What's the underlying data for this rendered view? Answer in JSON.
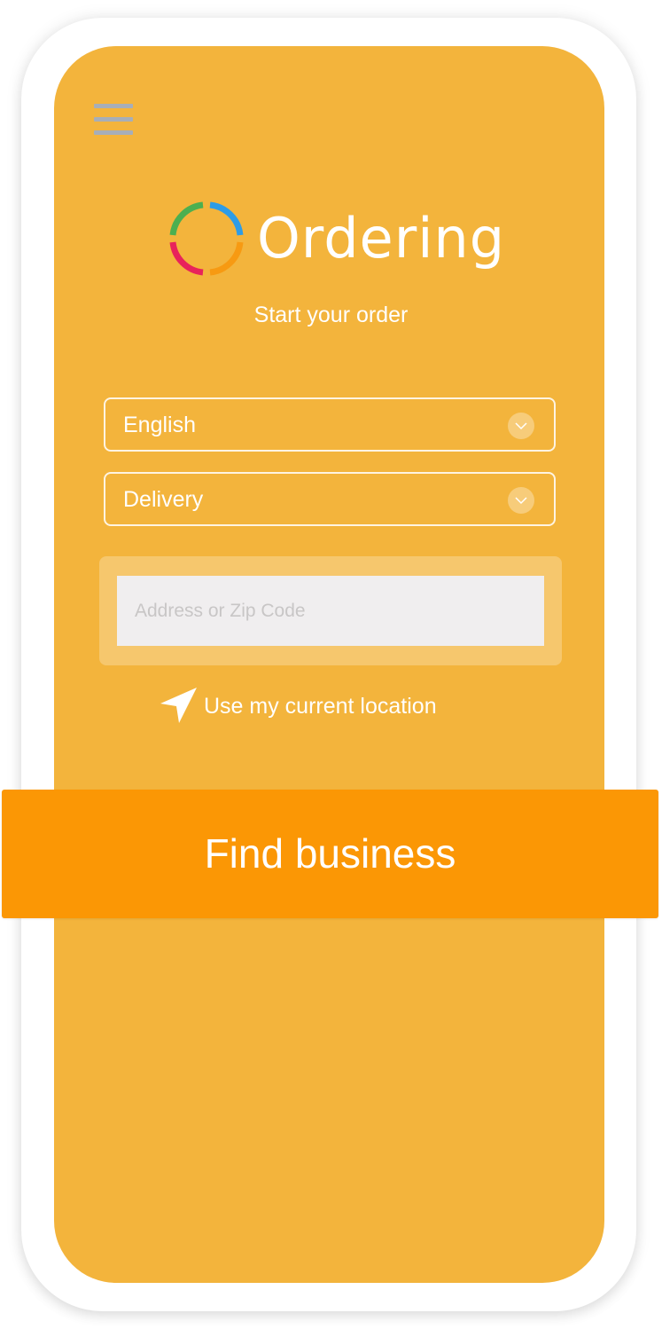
{
  "app": {
    "name": "Ordering",
    "subtitle": "Start your order"
  },
  "header": {
    "menu_icon": "hamburger-menu-icon"
  },
  "colors": {
    "screen_background": "#F3B43C",
    "primary_button": "#FB9705",
    "menu_icon": "#A7AEB8",
    "input_background": "#F0EEEF",
    "logo_ring": [
      "#2E9CE6",
      "#F79A12",
      "#E8235B",
      "#4CAF50"
    ]
  },
  "form": {
    "language_select": {
      "value": "English",
      "icon": "chevron-down-icon"
    },
    "order_type_select": {
      "value": "Delivery",
      "icon": "chevron-down-icon"
    },
    "address_input": {
      "value": "",
      "placeholder": "Address or Zip Code"
    },
    "current_location": {
      "label": "Use my current location",
      "icon": "navigation-arrow-icon"
    }
  },
  "actions": {
    "find_business_label": "Find business"
  }
}
